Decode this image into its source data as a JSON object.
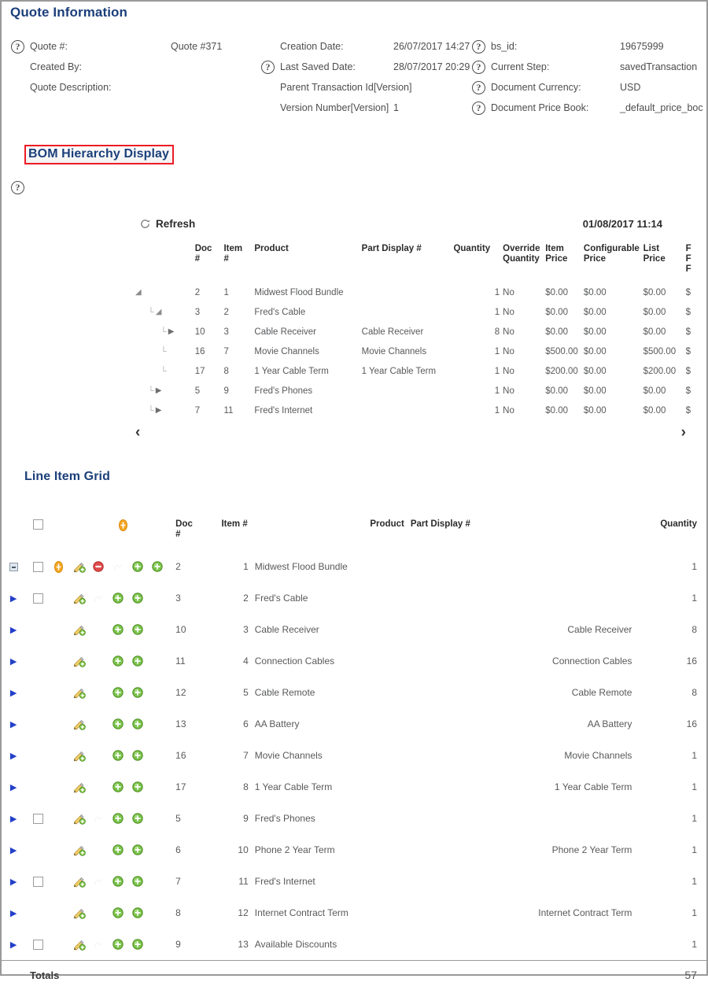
{
  "quote_info": {
    "title": "Quote Information",
    "col1": [
      {
        "icon": "help-icon",
        "has_icon": true,
        "label": "Quote #:",
        "value": "Quote #371"
      },
      {
        "icon": "help-icon",
        "has_icon": false,
        "label": "Created By:",
        "value": ""
      },
      {
        "icon": "help-icon",
        "has_icon": false,
        "label": "Quote Description:",
        "value": ""
      }
    ],
    "col2": [
      {
        "has_icon": false,
        "label": "Creation Date:",
        "value": "26/07/2017 14:27"
      },
      {
        "has_icon": true,
        "label": "Last Saved Date:",
        "value": "28/07/2017 20:29"
      },
      {
        "has_icon": false,
        "label": "Parent Transaction Id[Version]",
        "value": ""
      },
      {
        "has_icon": false,
        "label": "Version Number[Version]",
        "value": "1"
      }
    ],
    "col3": [
      {
        "has_icon": true,
        "label": "bs_id:",
        "value": "19675999"
      },
      {
        "has_icon": true,
        "label": "Current Step:",
        "value": "savedTransaction"
      },
      {
        "has_icon": true,
        "label": "Document Currency:",
        "value": "USD"
      },
      {
        "has_icon": true,
        "label": "Document Price Book:",
        "value": "_default_price_boc"
      }
    ]
  },
  "bom": {
    "title": "BOM Hierarchy Display",
    "title_highlight_color": "#ec1c24",
    "refresh_label": "Refresh",
    "timestamp": "01/08/2017 11:14",
    "prev_arrow": "‹",
    "next_arrow": "›",
    "headers": {
      "tree": "",
      "doc": "Doc\n#",
      "doc_l1": "Doc",
      "doc_l2": "#",
      "item_l1": "Item",
      "item_l2": "#",
      "product": "Product",
      "part": "Part Display #",
      "quantity": "Quantity",
      "override_l1": "Override",
      "override_l2": "Quantity",
      "item_price_l1": "Item",
      "item_price_l2": "Price",
      "config_l1": "Configurable",
      "config_l2": "Price",
      "list_l1": "List",
      "list_l2": "Price",
      "cut_l1": "F",
      "cut_l2": "F",
      "cut_l3": "F"
    },
    "rows": [
      {
        "indent": 0,
        "connector": false,
        "toggle": "down",
        "doc": "2",
        "item": "1",
        "product": "Midwest Flood Bundle",
        "part": "",
        "quantity": "1",
        "override": "No",
        "item_price": "$0.00",
        "config_price": "$0.00",
        "list_price": "$0.00",
        "cut": "$"
      },
      {
        "indent": 1,
        "connector": true,
        "toggle": "down",
        "doc": "3",
        "item": "2",
        "product": "Fred's Cable",
        "part": "",
        "quantity": "1",
        "override": "No",
        "item_price": "$0.00",
        "config_price": "$0.00",
        "list_price": "$0.00",
        "cut": "$"
      },
      {
        "indent": 2,
        "connector": true,
        "toggle": "right",
        "doc": "10",
        "item": "3",
        "product": "Cable Receiver",
        "part": "Cable Receiver",
        "quantity": "8",
        "override": "No",
        "item_price": "$0.00",
        "config_price": "$0.00",
        "list_price": "$0.00",
        "cut": "$"
      },
      {
        "indent": 2,
        "connector": true,
        "toggle": "none",
        "doc": "16",
        "item": "7",
        "product": "Movie Channels",
        "part": "Movie Channels",
        "quantity": "1",
        "override": "No",
        "item_price": "$500.00",
        "config_price": "$0.00",
        "list_price": "$500.00",
        "cut": "$"
      },
      {
        "indent": 2,
        "connector": true,
        "toggle": "none",
        "doc": "17",
        "item": "8",
        "product": "1 Year Cable Term",
        "part": "1 Year Cable Term",
        "quantity": "1",
        "override": "No",
        "item_price": "$200.00",
        "config_price": "$0.00",
        "list_price": "$200.00",
        "cut": "$"
      },
      {
        "indent": 1,
        "connector": true,
        "toggle": "right",
        "doc": "5",
        "item": "9",
        "product": "Fred's Phones",
        "part": "",
        "quantity": "1",
        "override": "No",
        "item_price": "$0.00",
        "config_price": "$0.00",
        "list_price": "$0.00",
        "cut": "$"
      },
      {
        "indent": 1,
        "connector": true,
        "toggle": "right",
        "doc": "7",
        "item": "11",
        "product": "Fred's Internet",
        "part": "",
        "quantity": "1",
        "override": "No",
        "item_price": "$0.00",
        "config_price": "$0.00",
        "list_price": "$0.00",
        "cut": "$"
      }
    ]
  },
  "line_item_grid": {
    "title": "Line Item Grid",
    "headers": {
      "doc_l1": "Doc",
      "doc_l2": "#",
      "item": "Item #",
      "product": "Product",
      "part": "Part Display #",
      "quantity": "Quantity"
    },
    "header_icons": [
      "select-all-checkbox",
      "add-line-item-icon"
    ],
    "rows": [
      {
        "toggle": "minus",
        "checkbox": true,
        "icons": [
          "add-orange-icon",
          "edit-pencil-icon",
          "delete-red-icon",
          "faint-icon",
          "green-add-icon",
          "green-add-icon"
        ],
        "doc": "2",
        "item": "1",
        "product": "Midwest Flood Bundle",
        "part": "",
        "quantity": "1"
      },
      {
        "toggle": "right",
        "checkbox": true,
        "icons": [
          "edit-pencil-icon",
          "faint-icon",
          "green-add-icon",
          "green-add-icon"
        ],
        "doc": "3",
        "item": "2",
        "product": "Fred's Cable",
        "part": "",
        "quantity": "1"
      },
      {
        "toggle": "right",
        "checkbox": false,
        "icons": [
          "edit-pencil-icon",
          "green-add-icon",
          "green-add-icon"
        ],
        "doc": "10",
        "item": "3",
        "product": "Cable Receiver",
        "part": "Cable Receiver",
        "quantity": "8"
      },
      {
        "toggle": "right",
        "checkbox": false,
        "icons": [
          "edit-pencil-icon",
          "green-add-icon",
          "green-add-icon"
        ],
        "doc": "11",
        "item": "4",
        "product": "Connection Cables",
        "part": "Connection Cables",
        "quantity": "16"
      },
      {
        "toggle": "right",
        "checkbox": false,
        "icons": [
          "edit-pencil-icon",
          "green-add-icon",
          "green-add-icon"
        ],
        "doc": "12",
        "item": "5",
        "product": "Cable Remote",
        "part": "Cable Remote",
        "quantity": "8"
      },
      {
        "toggle": "right",
        "checkbox": false,
        "icons": [
          "edit-pencil-icon",
          "green-add-icon",
          "green-add-icon"
        ],
        "doc": "13",
        "item": "6",
        "product": "AA Battery",
        "part": "AA Battery",
        "quantity": "16"
      },
      {
        "toggle": "right",
        "checkbox": false,
        "icons": [
          "edit-pencil-icon",
          "green-add-icon",
          "green-add-icon"
        ],
        "doc": "16",
        "item": "7",
        "product": "Movie Channels",
        "part": "Movie Channels",
        "quantity": "1"
      },
      {
        "toggle": "right",
        "checkbox": false,
        "icons": [
          "edit-pencil-icon",
          "green-add-icon",
          "green-add-icon"
        ],
        "doc": "17",
        "item": "8",
        "product": "1 Year Cable Term",
        "part": "1 Year Cable Term",
        "quantity": "1"
      },
      {
        "toggle": "right",
        "checkbox": true,
        "icons": [
          "edit-pencil-icon",
          "faint-icon",
          "green-add-icon",
          "green-add-icon"
        ],
        "doc": "5",
        "item": "9",
        "product": "Fred's Phones",
        "part": "",
        "quantity": "1"
      },
      {
        "toggle": "right",
        "checkbox": false,
        "icons": [
          "edit-pencil-icon",
          "green-add-icon",
          "green-add-icon"
        ],
        "doc": "6",
        "item": "10",
        "product": "Phone 2 Year Term",
        "part": "Phone 2 Year Term",
        "quantity": "1"
      },
      {
        "toggle": "right",
        "checkbox": true,
        "icons": [
          "edit-pencil-icon",
          "faint-icon",
          "green-add-icon",
          "green-add-icon"
        ],
        "doc": "7",
        "item": "11",
        "product": "Fred's Internet",
        "part": "",
        "quantity": "1"
      },
      {
        "toggle": "right",
        "checkbox": false,
        "icons": [
          "edit-pencil-icon",
          "green-add-icon",
          "green-add-icon"
        ],
        "doc": "8",
        "item": "12",
        "product": "Internet Contract Term",
        "part": "Internet Contract Term",
        "quantity": "1"
      },
      {
        "toggle": "right",
        "checkbox": true,
        "icons": [
          "edit-pencil-icon",
          "faint-icon",
          "green-add-icon",
          "green-add-icon"
        ],
        "doc": "9",
        "item": "13",
        "product": "Available Discounts",
        "part": "",
        "quantity": "1"
      }
    ],
    "totals_label": "Totals",
    "totals_quantity": "57"
  },
  "colors": {
    "heading_blue": "#1b3f7a",
    "highlight_red": "#ec1c24",
    "text_gray": "#58595b",
    "icon_orange": "#f5a623",
    "icon_green": "#5cb85c",
    "icon_red": "#d9534f",
    "tree_blue": "#2340c8"
  }
}
